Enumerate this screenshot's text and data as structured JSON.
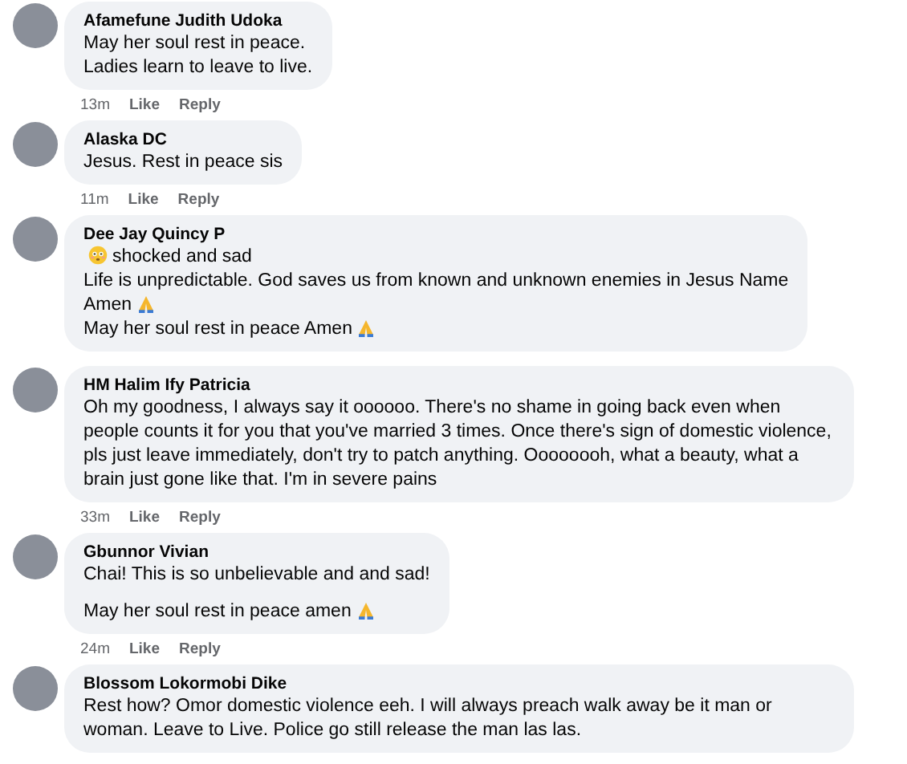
{
  "comments": [
    {
      "author": "Afamefune Judith Udoka",
      "paragraphs": [
        [
          {
            "text": "May her soul rest in peace."
          },
          {
            "text": "Ladies learn to leave to live."
          }
        ]
      ],
      "meta": {
        "time": "13m",
        "like": "Like",
        "reply": "Reply"
      }
    },
    {
      "author": "Alaska DC",
      "paragraphs": [
        [
          {
            "text": "Jesus. Rest in peace sis"
          }
        ]
      ],
      "meta": {
        "time": "11m",
        "like": "Like",
        "reply": "Reply"
      }
    },
    {
      "author": "Dee Jay Quincy P",
      "paragraphs": [
        [
          {
            "text": "shocked and sad",
            "flushed_before": true
          },
          {
            "text": "Life is unpredictable. God saves us from known and unknown enemies in Jesus Name"
          },
          {
            "text": "Amen",
            "pray_after": true
          },
          {
            "text": "May her soul rest in peace Amen",
            "pray_after": true
          }
        ]
      ]
    },
    {
      "author": "HM Halim Ify Patricia",
      "paragraphs": [
        [
          {
            "text": "Oh my goodness, I always say it oooooo. There's no shame in going back even when people counts it for you that you've married 3 times. Once there's sign of domestic violence, pls just leave immediately, don't try to patch anything. Oooooooh, what a beauty, what a brain just gone like that. I'm in severe pains"
          }
        ]
      ],
      "meta": {
        "time": "33m",
        "like": "Like",
        "reply": "Reply"
      }
    },
    {
      "author": "Gbunnor Vivian",
      "paragraphs": [
        [
          {
            "text": "Chai! This is so unbelievable and and sad!"
          }
        ],
        [
          {
            "text": "May her soul rest in peace amen",
            "pray_after": true
          }
        ]
      ],
      "meta": {
        "time": "24m",
        "like": "Like",
        "reply": "Reply"
      }
    },
    {
      "author": "Blossom Lokormobi Dike",
      "paragraphs": [
        [
          {
            "text": "Rest how? Omor domestic violence eeh. I will always preach walk away be it man or woman. Leave to Live. Police go still release the man las las."
          }
        ]
      ]
    }
  ]
}
